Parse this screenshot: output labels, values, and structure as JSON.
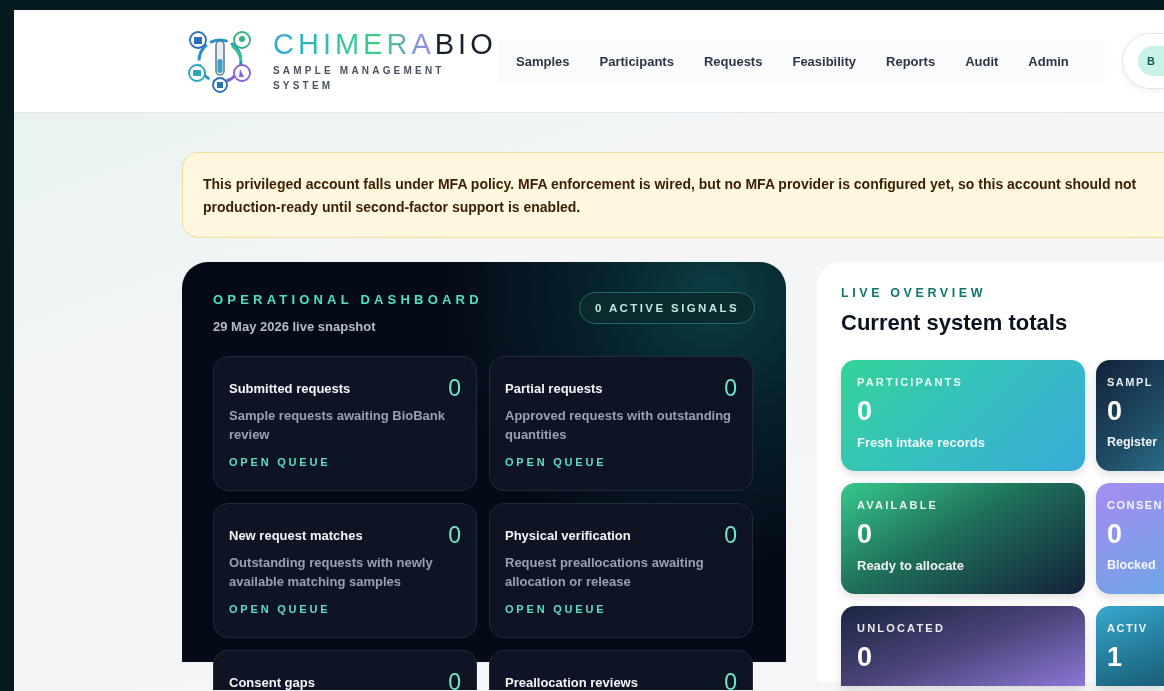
{
  "brand": {
    "accent": "CHIMERA",
    "rest": "BIO",
    "subtitle": "SAMPLE MANAGEMENT SYSTEM"
  },
  "nav": [
    "Samples",
    "Participants",
    "Requests",
    "Feasibility",
    "Reports",
    "Audit",
    "Admin"
  ],
  "user": {
    "initial": "B"
  },
  "alert": {
    "lines": [
      "This privileged account falls under MFA policy. MFA enforcement is wired, but no MFA provider is configured yet, so this account should not",
      "production-ready until second-factor support is enabled."
    ]
  },
  "dashboard": {
    "eyebrow": "OPERATIONAL DASHBOARD",
    "date": "29 May 2026 live snapshot",
    "signals": "0 ACTIVE SIGNALS",
    "tiles": [
      {
        "title": "Submitted requests",
        "count": "0",
        "description": "Sample requests awaiting BioBank review",
        "action": "OPEN QUEUE"
      },
      {
        "title": "Partial requests",
        "count": "0",
        "description": "Approved requests with outstanding quantities",
        "action": "OPEN QUEUE"
      },
      {
        "title": "New request matches",
        "count": "0",
        "description": "Outstanding requests with newly available matching samples",
        "action": "OPEN QUEUE"
      },
      {
        "title": "Physical verification",
        "count": "0",
        "description": "Request preallocations awaiting allocation or release",
        "action": "OPEN QUEUE"
      },
      {
        "title": "Consent gaps",
        "count": "0"
      },
      {
        "title": "Preallocation reviews",
        "count": "0"
      }
    ]
  },
  "overview": {
    "eyebrow": "LIVE OVERVIEW",
    "title": "Current system totals",
    "stats": [
      {
        "label": "PARTICIPANTS",
        "value": "0",
        "note": "Fresh intake records",
        "kind": "aqua"
      },
      {
        "label": "SAMPL",
        "value": "0",
        "note": "Register",
        "kind": "navy"
      },
      {
        "label": "AVAILABLE",
        "value": "0",
        "note": "Ready to allocate",
        "kind": "forest"
      },
      {
        "label": "CONSEN",
        "value": "0",
        "note": "Blocked",
        "kind": "lavender"
      },
      {
        "label": "UNLOCATED",
        "value": "0",
        "kind": "dusk"
      },
      {
        "label": "ACTIV",
        "value": "1",
        "kind": "ocean"
      }
    ]
  }
}
